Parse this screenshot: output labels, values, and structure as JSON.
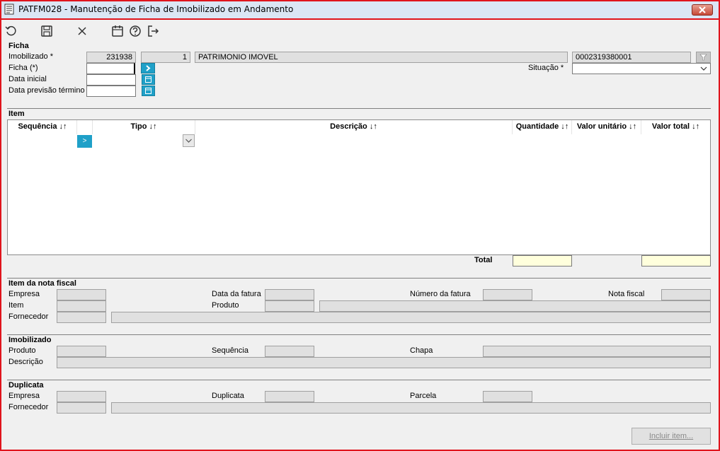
{
  "window": {
    "title": "PATFM028 - Manutenção de Ficha de Imobilizado em Andamento"
  },
  "toolbar": {
    "icons": [
      "undo-icon",
      "save-icon",
      "cancel-icon",
      "calendar-icon",
      "help-icon",
      "exit-icon"
    ]
  },
  "ficha": {
    "section_title": "Ficha",
    "imobilizado_label": "Imobilizado *",
    "imobilizado_code": "231938",
    "imobilizado_seq": "1",
    "imobilizado_desc": "PATRIMONIO IMOVEL",
    "imobilizado_chapa": "0002319380001",
    "ficha_label": "Ficha (*)",
    "ficha_value": "",
    "data_inicial_label": "Data inicial",
    "data_inicial_value": "",
    "data_previsao_label": "Data previsão término",
    "data_previsao_value": "",
    "situacao_label": "Situação *",
    "situacao_value": ""
  },
  "item": {
    "section_title": "Item",
    "columns": {
      "sequencia": "Sequência ↓↑",
      "tipo": "Tipo ↓↑",
      "descricao": "Descrição ↓↑",
      "quantidade": "Quantidade ↓↑",
      "valor_unitario": "Valor unitário ↓↑",
      "valor_total": "Valor total ↓↑"
    },
    "row_arrow": ">",
    "total_label": "Total",
    "total_quantidade": "",
    "total_valor": ""
  },
  "nota_fiscal": {
    "section_title": "Item da nota fiscal",
    "empresa_label": "Empresa",
    "data_fatura_label": "Data da fatura",
    "numero_fatura_label": "Número da fatura",
    "nota_fiscal_label": "Nota fiscal",
    "item_label": "Item",
    "produto_label": "Produto",
    "fornecedor_label": "Fornecedor"
  },
  "imobilizado": {
    "section_title": "Imobilizado",
    "produto_label": "Produto",
    "sequencia_label": "Sequência",
    "chapa_label": "Chapa",
    "descricao_label": "Descrição"
  },
  "duplicata": {
    "section_title": "Duplicata",
    "empresa_label": "Empresa",
    "duplicata_label": "Duplicata",
    "parcela_label": "Parcela",
    "fornecedor_label": "Fornecedor"
  },
  "actions": {
    "incluir_item": "Incluir item..."
  },
  "colors": {
    "title_border": "#e0141c",
    "accent": "#1fa0c8",
    "total_field": "#ffffdc"
  }
}
